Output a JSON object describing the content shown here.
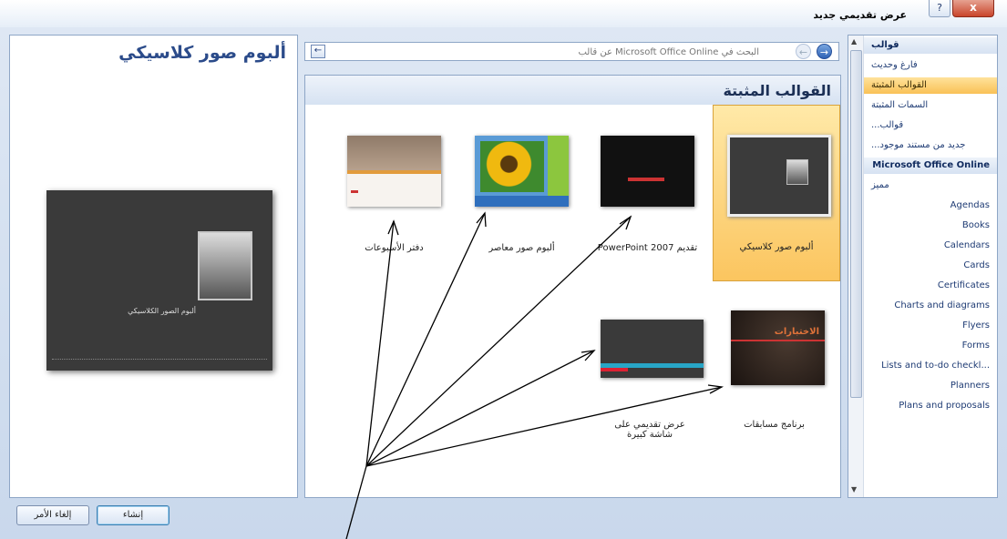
{
  "window": {
    "title": "عرض تقديمي جديد",
    "close_glyph": "x",
    "help_glyph": "?"
  },
  "preview": {
    "title": "ألبوم صور كلاسيكي",
    "caption": "ألبوم الصور الكلاسيكي"
  },
  "search": {
    "placeholder": "البحث في Microsoft Office Online عن قالب",
    "back_glyph": "←",
    "prev_glyph": "←",
    "next_glyph": "→"
  },
  "gallery": {
    "title": "القوالب المثبتة",
    "tiles": [
      {
        "label": "ألبوم صور كلاسيكي",
        "selected": true
      },
      {
        "label": "تقديم PowerPoint 2007"
      },
      {
        "label": "ألبوم صور معاصر"
      },
      {
        "label": "دفتر الأسبوعات"
      },
      {
        "label": "برنامج مسابقات",
        "thumb_text": "الاختبارات"
      },
      {
        "label": "عرض تقديمي على شاشة كبيرة"
      }
    ]
  },
  "sidebar": {
    "items": [
      {
        "label": "قوالب",
        "type": "header"
      },
      {
        "label": "فارغ وحديث"
      },
      {
        "label": "القوالب المثبتة",
        "active": true
      },
      {
        "label": "السمات المثبتة"
      },
      {
        "label": "قوالب..."
      },
      {
        "label": "جديد من مستند موجود..."
      },
      {
        "label": "Microsoft Office Online",
        "type": "header"
      },
      {
        "label": "مميز"
      },
      {
        "label": "Agendas"
      },
      {
        "label": "Books"
      },
      {
        "label": "Calendars"
      },
      {
        "label": "Cards"
      },
      {
        "label": "Certificates"
      },
      {
        "label": "Charts and diagrams"
      },
      {
        "label": "Flyers"
      },
      {
        "label": "Forms"
      },
      {
        "label": "Lists and to-do checkl..."
      },
      {
        "label": "Planners"
      },
      {
        "label": "Plans and proposals"
      }
    ]
  },
  "buttons": {
    "create": "إنشاء",
    "cancel": "إلغاء الأمر"
  }
}
